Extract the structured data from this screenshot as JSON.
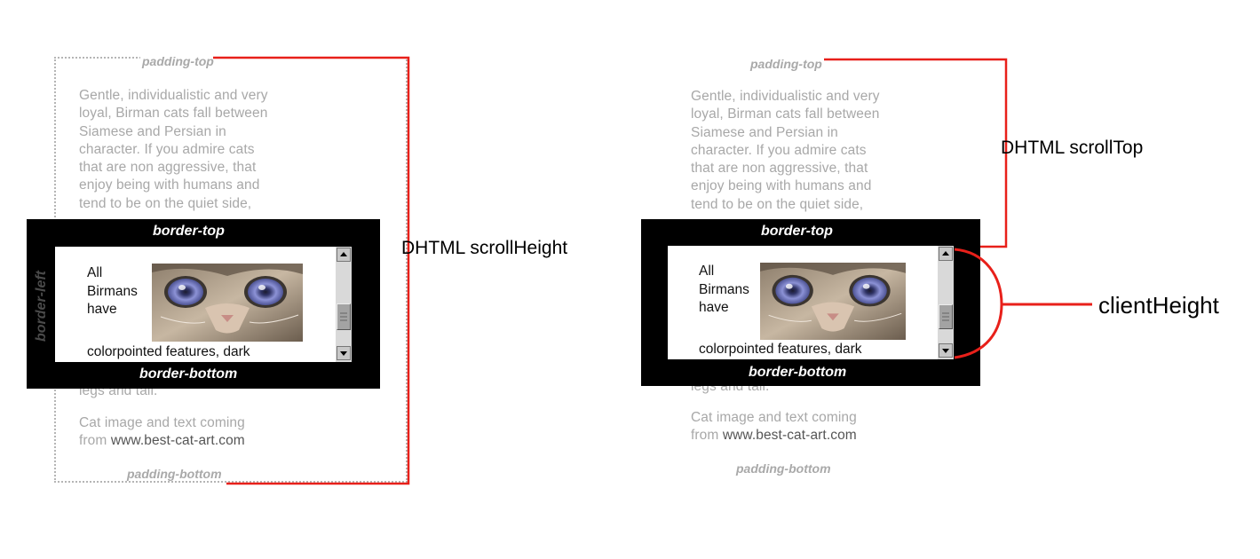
{
  "left": {
    "padding_top": "padding-top",
    "padding_bottom": "padding-bottom",
    "border_top": "border-top",
    "border_bottom": "border-bottom",
    "border_left": "border-left",
    "para1": [
      "Gentle, individualistic and very",
      "loyal, Birman cats fall between",
      "Siamese and Persian in",
      "character. If you admire cats",
      "that are non aggressive, that",
      "enjoy being with humans and",
      "tend to be on the quiet side,"
    ],
    "hidden_below": "legs and tail.",
    "credit_line1": "Cat image and text coming",
    "credit_from": "from ",
    "credit_site": "www.best-cat-art.com",
    "viewport_words": [
      "All",
      "Birmans",
      "have"
    ],
    "viewport_line": "colorpointed features, dark",
    "label": "DHTML scrollHeight"
  },
  "right": {
    "padding_top": "padding-top",
    "padding_bottom": "padding-bottom",
    "border_top": "border-top",
    "border_bottom": "border-bottom",
    "para1": [
      "Gentle, individualistic and very",
      "loyal, Birman cats fall between",
      "Siamese and Persian in",
      "character. If you admire cats",
      "that are non aggressive, that",
      "enjoy being with humans and",
      "tend to be on the quiet side,"
    ],
    "hidden_below": "legs and tail.",
    "credit_line1": "Cat image and text coming",
    "credit_from": "from ",
    "credit_site": "www.best-cat-art.com",
    "viewport_words": [
      "All",
      "Birmans",
      "have"
    ],
    "viewport_line": "colorpointed features, dark",
    "label_scrolltop": "DHTML scrollTop",
    "label_clientheight": "clientHeight"
  },
  "colors": {
    "annotation_line": "#e8201a",
    "border": "#000000",
    "faded_text": "#a8a8a8"
  },
  "icons": [
    "cat-face-image",
    "scroll-up-arrow-icon",
    "scroll-down-arrow-icon"
  ]
}
